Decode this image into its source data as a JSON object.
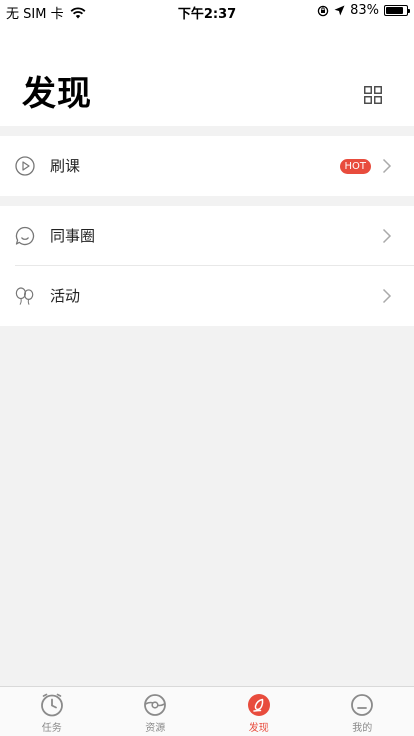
{
  "status_bar": {
    "carrier": "无 SIM 卡",
    "time": "下午2:37",
    "battery": "83%",
    "battery_level": 0.83
  },
  "header": {
    "title": "发现"
  },
  "menu": {
    "shuake": {
      "label": "刷课",
      "badge": "HOT"
    },
    "tongshiquan": {
      "label": "同事圈"
    },
    "huodong": {
      "label": "活动"
    }
  },
  "tab_bar": {
    "items": [
      {
        "label": "任务",
        "icon": "task-clock-icon",
        "active": false
      },
      {
        "label": "资源",
        "icon": "resource-icon",
        "active": false
      },
      {
        "label": "发现",
        "icon": "discover-icon",
        "active": true
      },
      {
        "label": "我的",
        "icon": "profile-icon",
        "active": false
      }
    ]
  },
  "colors": {
    "accent": "#e84c3d",
    "inactive": "#8a8a8a",
    "background": "#f2f2f2"
  }
}
